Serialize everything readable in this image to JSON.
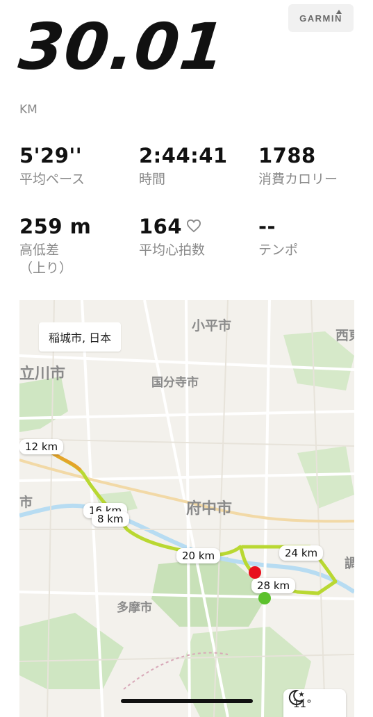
{
  "header": {
    "distance": "30.01",
    "unit": "KM",
    "brand": "GARMIN"
  },
  "stats": [
    {
      "value": "5'29''",
      "label": "平均ペース"
    },
    {
      "value": "2:44:41",
      "label": "時間"
    },
    {
      "value": "1788",
      "label": "消費カロリー"
    },
    {
      "value": "259 m",
      "label": "高低差\n（上り）"
    },
    {
      "value": "164",
      "label": "平均心拍数"
    },
    {
      "value": "--",
      "label": "テンポ"
    }
  ],
  "map": {
    "location": "稲城市, 日本",
    "place_labels": [
      "小平市",
      "西東",
      "立川市",
      "国分寺市",
      "府中市",
      "市",
      "多摩市",
      "調"
    ],
    "km_markers": [
      "12 km",
      "16 km",
      "8 km",
      "20 km",
      "24 km",
      "28 km"
    ],
    "weather": {
      "temp": "11°",
      "icon": "moon-star-icon"
    },
    "route_color": "#b9d832",
    "start_color": "#5cc12c",
    "end_color": "#e8101c"
  }
}
